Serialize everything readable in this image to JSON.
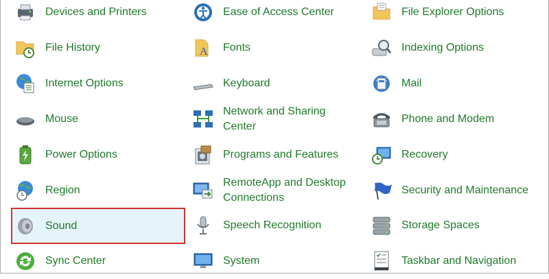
{
  "items": [
    {
      "label": "Devices and Printers",
      "icon": "printer-icon"
    },
    {
      "label": "Ease of Access Center",
      "icon": "ease-of-access-icon"
    },
    {
      "label": "File Explorer Options",
      "icon": "folder-options-icon"
    },
    {
      "label": "File History",
      "icon": "file-history-icon"
    },
    {
      "label": "Fonts",
      "icon": "fonts-icon"
    },
    {
      "label": "Indexing Options",
      "icon": "indexing-icon"
    },
    {
      "label": "Internet Options",
      "icon": "internet-options-icon"
    },
    {
      "label": "Keyboard",
      "icon": "keyboard-icon"
    },
    {
      "label": "Mail",
      "icon": "mail-icon"
    },
    {
      "label": "Mouse",
      "icon": "mouse-icon"
    },
    {
      "label": "Network and Sharing Center",
      "icon": "network-icon"
    },
    {
      "label": "Phone and Modem",
      "icon": "phone-icon"
    },
    {
      "label": "Power Options",
      "icon": "power-icon"
    },
    {
      "label": "Programs and Features",
      "icon": "programs-icon"
    },
    {
      "label": "Recovery",
      "icon": "recovery-icon"
    },
    {
      "label": "Region",
      "icon": "region-icon"
    },
    {
      "label": "RemoteApp and Desktop Connections",
      "icon": "remoteapp-icon"
    },
    {
      "label": "Security and Maintenance",
      "icon": "security-flag-icon"
    },
    {
      "label": "Sound",
      "icon": "speaker-icon"
    },
    {
      "label": "Speech Recognition",
      "icon": "microphone-icon"
    },
    {
      "label": "Storage Spaces",
      "icon": "storage-icon"
    },
    {
      "label": "Sync Center",
      "icon": "sync-icon"
    },
    {
      "label": "System",
      "icon": "system-icon"
    },
    {
      "label": "Taskbar and Navigation",
      "icon": "taskbar-icon"
    }
  ],
  "selected": "Sound",
  "colors": {
    "link": "#1e7a2a",
    "selected_bg": "#e5f3fb",
    "highlight_border": "#d32f2f"
  }
}
